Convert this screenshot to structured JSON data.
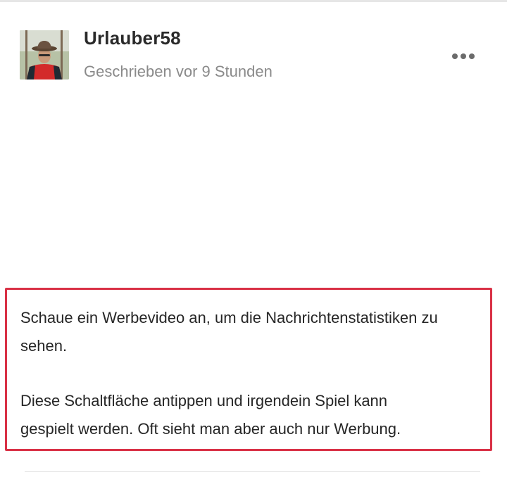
{
  "post": {
    "author": "Urlauber58",
    "timestamp": "Geschrieben vor 9 Stunden",
    "more_icon": "more-horizontal-icon",
    "avatar_icon": "user-avatar-photo"
  },
  "message": {
    "paragraph1_line1": "Schaue ein Werbevideo an, um die Nachrichtenstatistiken zu",
    "paragraph1_line2": "sehen.",
    "paragraph2_line1": "Diese Schaltfläche antippen und irgendein Spiel kann",
    "paragraph2_line2": "gespielt werden. Oft sieht man aber auch nur Werbung."
  },
  "colors": {
    "highlight_border": "#d93146",
    "author_text": "#2a2a2a",
    "meta_text": "#8a8a8a",
    "more_dots": "#6b6b6b"
  }
}
